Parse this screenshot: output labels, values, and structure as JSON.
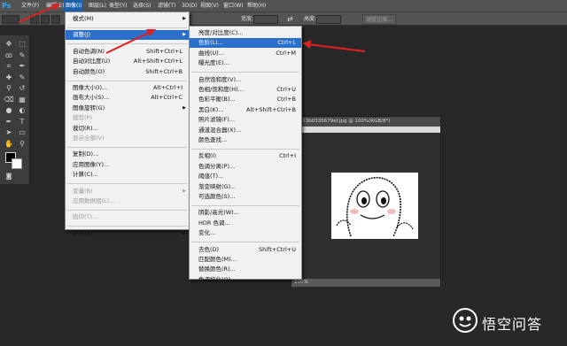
{
  "app": {
    "logo": "Ps"
  },
  "menubar": [
    {
      "label": "文件(F)",
      "active": false
    },
    {
      "label": "编辑(E)",
      "active": false
    },
    {
      "label": "图像(I)",
      "active": true
    },
    {
      "label": "图层(L)",
      "active": false
    },
    {
      "label": "类型(Y)",
      "active": false
    },
    {
      "label": "选择(S)",
      "active": false
    },
    {
      "label": "滤镜(T)",
      "active": false
    },
    {
      "label": "3D(D)",
      "active": false
    },
    {
      "label": "视图(V)",
      "active": false
    },
    {
      "label": "窗口(W)",
      "active": false
    },
    {
      "label": "帮助(H)",
      "active": false
    }
  ],
  "optionsbar": {
    "width_label": "宽度:",
    "height_label": "高度:",
    "adjust_edge_button": "调整边缘..."
  },
  "image_menu": [
    {
      "label": "模式(M)",
      "submenu": true
    },
    {
      "separator": true
    },
    {
      "label": "调整(J)",
      "submenu": true,
      "highlighted": true
    },
    {
      "separator": true
    },
    {
      "label": "自动色调(N)",
      "shortcut": "Shift+Ctrl+L"
    },
    {
      "label": "自动对比度(U)",
      "shortcut": "Alt+Shift+Ctrl+L"
    },
    {
      "label": "自动颜色(O)",
      "shortcut": "Shift+Ctrl+B"
    },
    {
      "separator": true
    },
    {
      "label": "图像大小(I)...",
      "shortcut": "Alt+Ctrl+I"
    },
    {
      "label": "画布大小(S)...",
      "shortcut": "Alt+Ctrl+C"
    },
    {
      "label": "图像旋转(G)",
      "submenu": true
    },
    {
      "label": "裁剪(P)",
      "disabled": true
    },
    {
      "label": "裁切(R)..."
    },
    {
      "label": "显示全部(V)",
      "disabled": true
    },
    {
      "separator": true
    },
    {
      "label": "复制(D)..."
    },
    {
      "label": "应用图像(Y)..."
    },
    {
      "label": "计算(C)..."
    },
    {
      "separator": true
    },
    {
      "label": "变量(B)",
      "submenu": true,
      "disabled": true
    },
    {
      "label": "应用数据组(L)...",
      "disabled": true
    },
    {
      "separator": true
    },
    {
      "label": "陷印(T)...",
      "disabled": true
    },
    {
      "separator": true
    },
    {
      "label": "分析(A)",
      "submenu": true
    }
  ],
  "adjust_menu": [
    {
      "label": "亮度/对比度(C)..."
    },
    {
      "label": "色阶(L)...",
      "shortcut": "Ctrl+L",
      "highlighted": true
    },
    {
      "label": "曲线(U)...",
      "shortcut": "Ctrl+M"
    },
    {
      "label": "曝光度(E)..."
    },
    {
      "separator": true
    },
    {
      "label": "自然饱和度(V)..."
    },
    {
      "label": "色相/饱和度(H)...",
      "shortcut": "Ctrl+U"
    },
    {
      "label": "色彩平衡(B)...",
      "shortcut": "Ctrl+B"
    },
    {
      "label": "黑白(K)...",
      "shortcut": "Alt+Shift+Ctrl+B"
    },
    {
      "label": "照片滤镜(F)..."
    },
    {
      "label": "通道混合器(X)..."
    },
    {
      "label": "颜色查找..."
    },
    {
      "separator": true
    },
    {
      "label": "反相(I)",
      "shortcut": "Ctrl+I"
    },
    {
      "label": "色调分离(P)..."
    },
    {
      "label": "阈值(T)..."
    },
    {
      "label": "渐变映射(G)..."
    },
    {
      "label": "可选颜色(S)..."
    },
    {
      "separator": true
    },
    {
      "label": "阴影/高光(W)..."
    },
    {
      "label": "HDR 色调..."
    },
    {
      "label": "变化..."
    },
    {
      "separator": true
    },
    {
      "label": "去色(D)",
      "shortcut": "Shift+Ctrl+U"
    },
    {
      "label": "匹配颜色(M)..."
    },
    {
      "label": "替换颜色(R)..."
    },
    {
      "label": "色调均化(Q)"
    }
  ],
  "document": {
    "tab_title": "aeb13b0335679ef.jpg @ 100%(RGB/8*)",
    "zoom": "100%"
  },
  "toolbox_icons": [
    "move-icon",
    "marquee-icon",
    "lasso-icon",
    "quick-select-icon",
    "crop-icon",
    "eyedropper-icon",
    "healing-icon",
    "brush-icon",
    "stamp-icon",
    "history-brush-icon",
    "eraser-icon",
    "gradient-icon",
    "blur-icon",
    "dodge-icon",
    "pen-icon",
    "type-icon",
    "path-select-icon",
    "shape-icon",
    "hand-icon",
    "zoom-icon"
  ],
  "colors": {
    "accent": "#2a6fc9",
    "annotation_arrow": "#e02020",
    "ps_blue": "#31a8ff"
  },
  "watermark": {
    "text": "悟空问答"
  }
}
